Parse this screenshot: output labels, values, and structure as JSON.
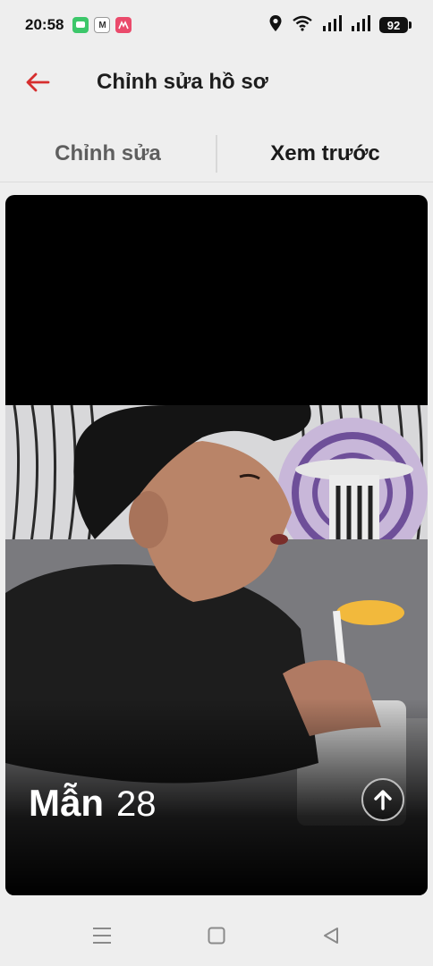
{
  "status_bar": {
    "time": "20:58",
    "notifications": [
      {
        "icon": "messages-icon",
        "color": "#3cc76a",
        "glyph": "▪"
      },
      {
        "icon": "gmail-icon",
        "color": "#444444",
        "glyph": "M"
      },
      {
        "icon": "gallery-app-icon",
        "color": "#ea4a6b",
        "glyph": "▪"
      }
    ],
    "battery": "92"
  },
  "header": {
    "title": "Chỉnh sửa hồ sơ",
    "back_color": "#d62e2e"
  },
  "tabs": [
    {
      "label": "Chỉnh sửa",
      "active": false
    },
    {
      "label": "Xem trước",
      "active": true
    }
  ],
  "profile": {
    "name": "Mẫn",
    "age": "28"
  },
  "nav": {
    "items": [
      "menu-icon",
      "home-square-icon",
      "back-triangle-icon"
    ]
  }
}
